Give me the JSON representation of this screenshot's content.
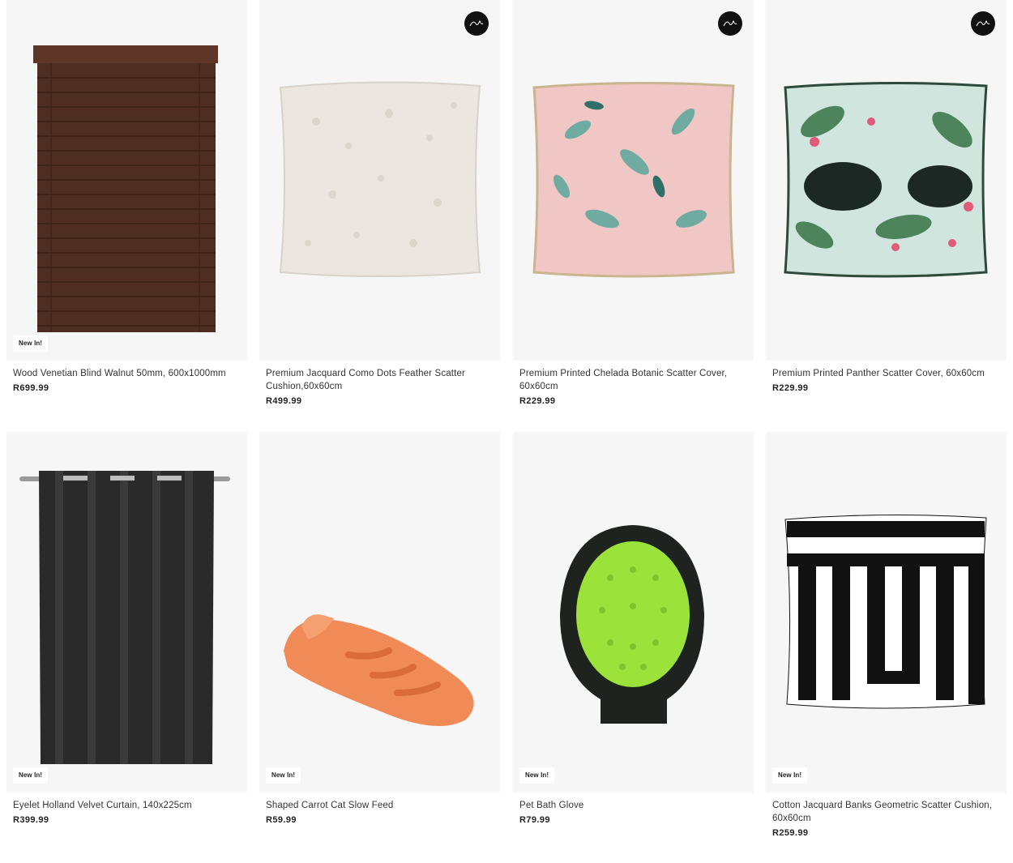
{
  "products": [
    {
      "name": "Wood Venetian Blind Walnut 50mm, 600x1000mm",
      "price": "R699.99",
      "badge": "New In!",
      "extra_logo": ""
    },
    {
      "name": "Premium Jacquard Como Dots Feather Scatter Cushion,60x60cm",
      "price": "R499.99",
      "badge": "",
      "extra_logo": "extra-logo"
    },
    {
      "name": "Premium Printed Chelada Botanic Scatter Cover, 60x60cm",
      "price": "R229.99",
      "badge": "",
      "extra_logo": "extra-logo"
    },
    {
      "name": "Premium Printed Panther Scatter Cover, 60x60cm",
      "price": "R229.99",
      "badge": "",
      "extra_logo": "extra-logo"
    },
    {
      "name": "Eyelet Holland Velvet Curtain, 140x225cm",
      "price": "R399.99",
      "badge": "New In!",
      "extra_logo": ""
    },
    {
      "name": "Shaped Carrot Cat Slow Feed",
      "price": "R59.99",
      "badge": "New In!",
      "extra_logo": ""
    },
    {
      "name": "Pet Bath Glove",
      "price": "R79.99",
      "badge": "New In!",
      "extra_logo": ""
    },
    {
      "name": "Cotton Jacquard Banks Geometric Scatter Cushion, 60x60cm",
      "price": "R259.99",
      "badge": "New In!",
      "extra_logo": ""
    }
  ],
  "colors": {
    "image_bg": "#f6f6f6",
    "blind": "#5a3426",
    "curtain": "#2a2a2a",
    "carrot": "#f08a57",
    "glove_green": "#9be33a"
  }
}
